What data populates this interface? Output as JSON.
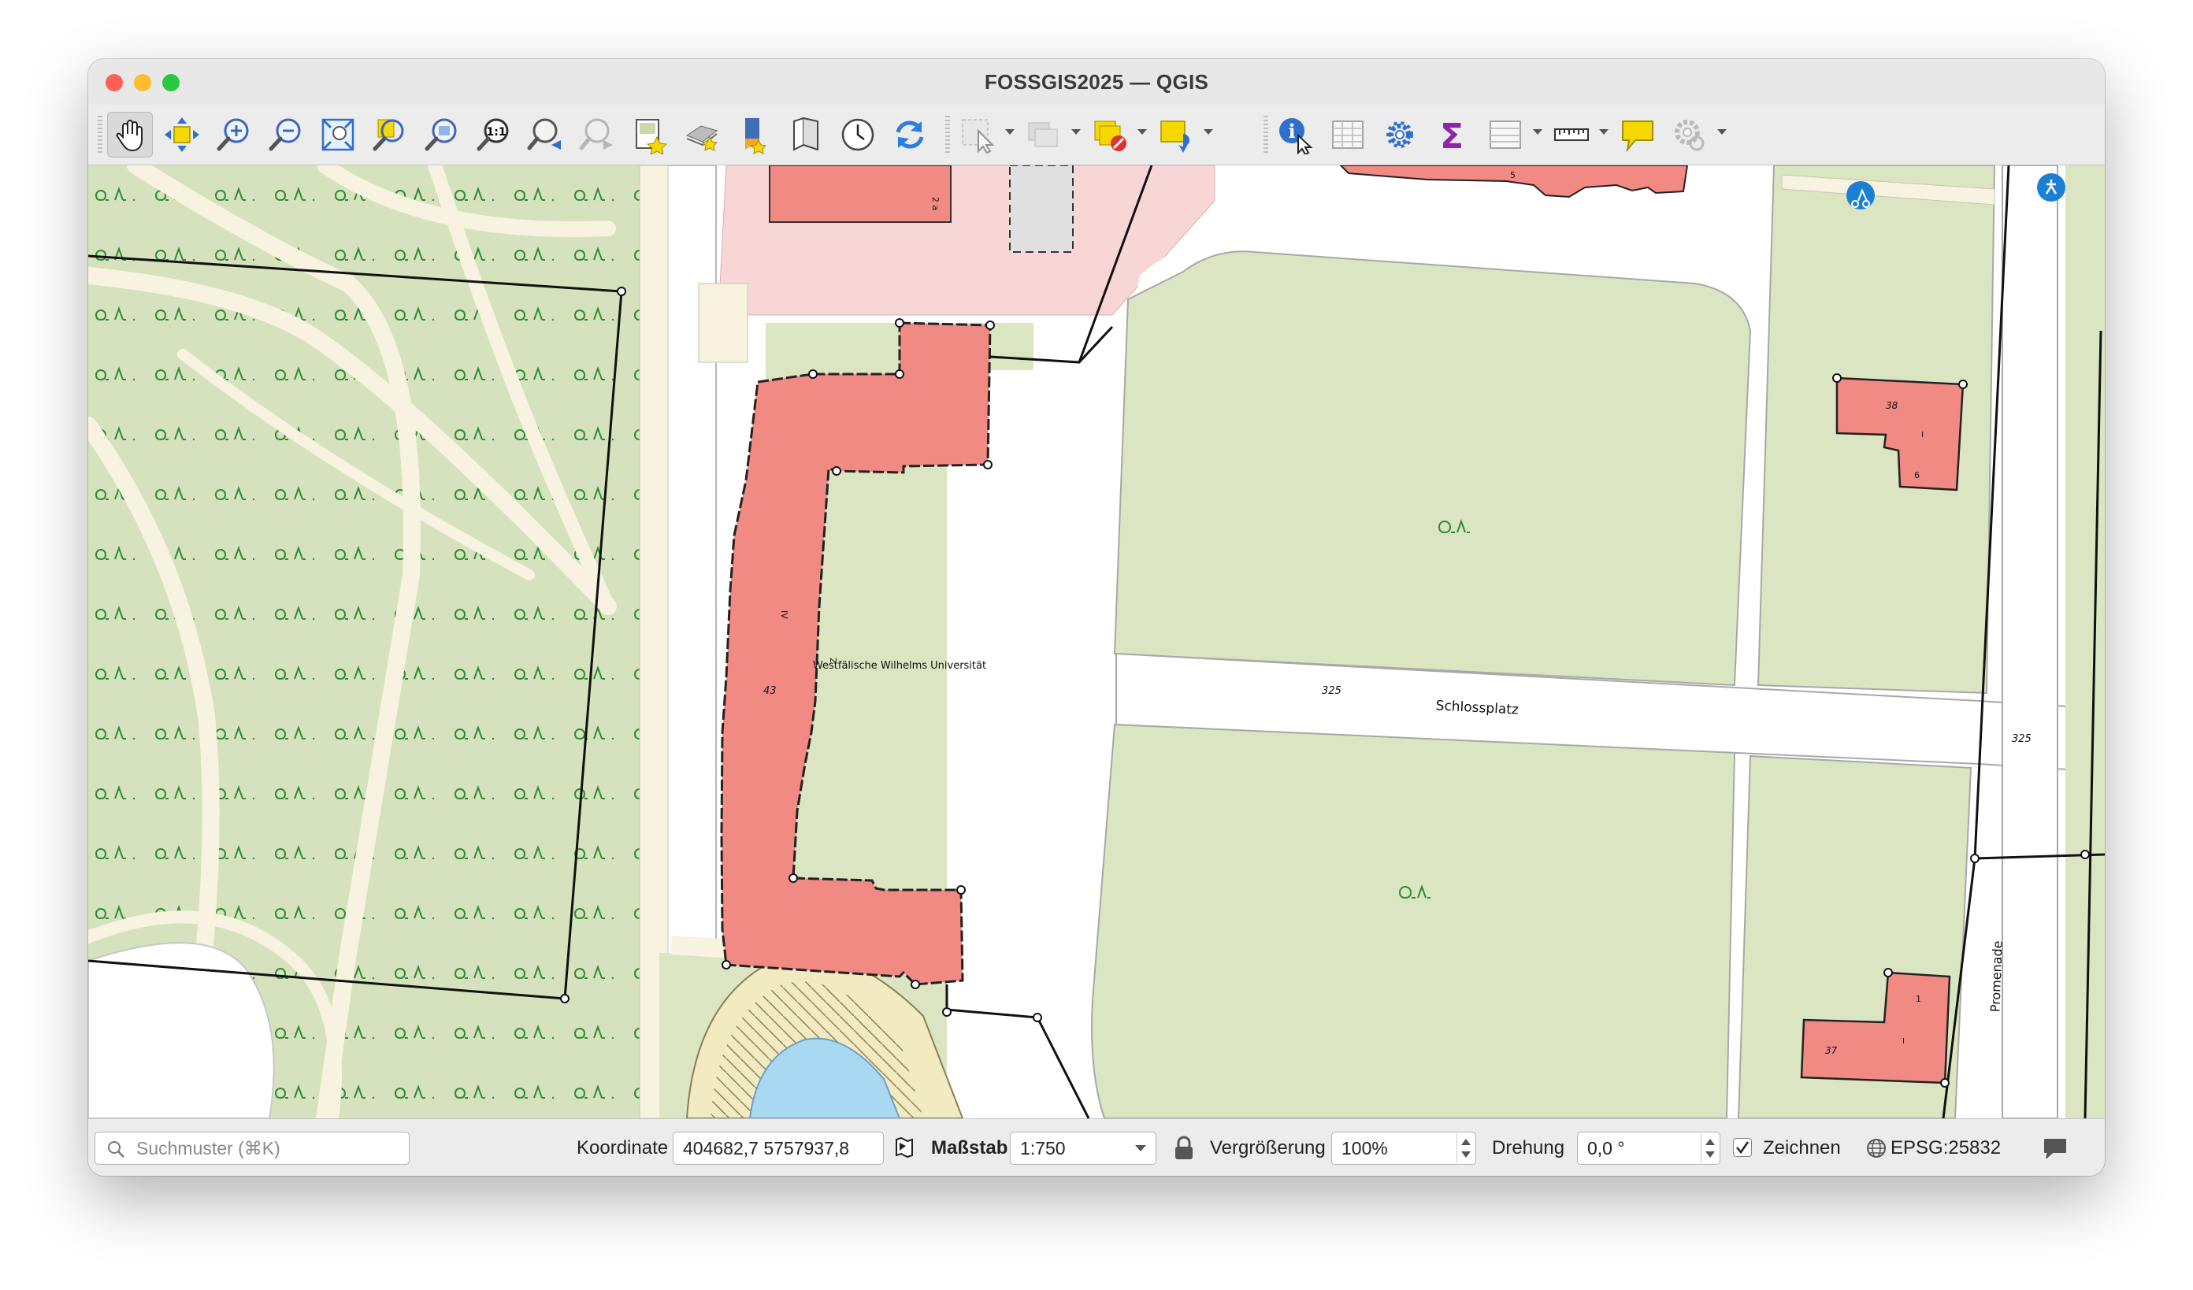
{
  "window": {
    "title": "FOSSGIS2025 — QGIS",
    "traffic_colors": {
      "close": "#fe5f57",
      "minimize": "#febc2e",
      "zoom": "#28c840"
    }
  },
  "toolbar": {
    "icons": [
      "pan-hand-icon",
      "pan-to-selection-icon",
      "zoom-in-icon",
      "zoom-out-icon",
      "zoom-full-icon",
      "zoom-to-selection-icon",
      "zoom-to-layer-icon",
      "zoom-native-icon",
      "zoom-last-icon",
      "zoom-next-icon",
      "new-bookmark-icon",
      "show-bookmarks-icon",
      "new-3d-map-icon",
      "temporal-controller-icon",
      "refresh-icon",
      "select-features-icon",
      "deselect-icon",
      "select-by-expression-icon",
      "identify-icon",
      "attribute-table-icon",
      "toolbox-icon",
      "statistics-icon",
      "field-calculator-icon",
      "measure-icon",
      "map-tips-icon",
      "settings-icon"
    ]
  },
  "map": {
    "labels": {
      "building_name": "Westfälische Wilhelms Universität",
      "street": "Schlossplatz",
      "street_right": "Promenade",
      "hn_325_a": "325",
      "hn_325_b": "325",
      "hn_43": "43",
      "hn_iv": "IV",
      "hn_2": "2",
      "hn_2a": "2 a",
      "hn_5": "5",
      "hn_38": "38",
      "hn_i1": "I",
      "hn_6": "6",
      "hn_1": "1",
      "hn_i2": "I",
      "hn_37": "37"
    },
    "colors": {
      "building": "#f28a84",
      "park": "#dbe5c2",
      "forest": "#d5e2bd",
      "path": "#f7f3e0",
      "pink_zone": "#f9d6d6",
      "water": "#a9d8f2"
    }
  },
  "statusbar": {
    "search_placeholder": "Suchmuster (⌘K)",
    "coordinate_label": "Koordinate",
    "coordinate_value": "404682,7  5757937,8",
    "scale_label": "Maßstab",
    "scale_value": "1:750",
    "magnifier_label": "Vergrößerung",
    "magnifier_value": "100%",
    "rotation_label": "Drehung",
    "rotation_value": "0,0 °",
    "render_label": "Zeichnen",
    "crs_label": "EPSG:25832"
  }
}
